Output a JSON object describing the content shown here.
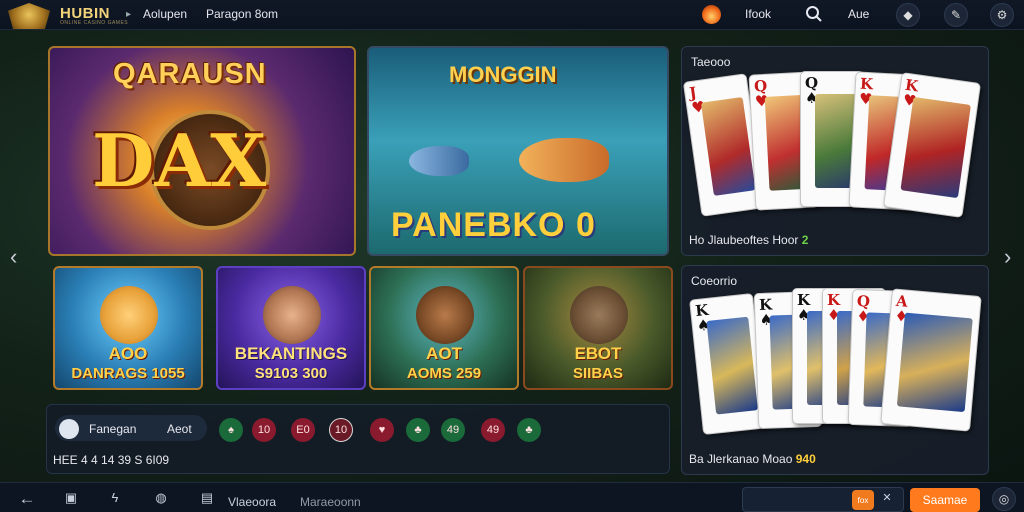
{
  "header": {
    "brand": "HUBIN",
    "brand_tagline": "ONLINE CASINO GAMES",
    "nav_links": [
      "Aolupen",
      "Paragon 8om"
    ],
    "right_links": [
      "Ifook",
      "Aue"
    ],
    "icons": [
      "fire-icon",
      "search-icon",
      "pin-icon",
      "edit-icon",
      "settings-icon"
    ]
  },
  "featured": [
    {
      "top_title": "QARAUSN",
      "main_title": "DAX"
    },
    {
      "top_title": "MONGGIN",
      "main_title": "PANEBKO 0"
    }
  ],
  "games": [
    {
      "line1": "AOO",
      "line2": "DANRAGS 1055"
    },
    {
      "line1": "BEKANTINGS",
      "line2": "S9103 300"
    },
    {
      "line1": "AOT",
      "line2": "AOMS 259"
    },
    {
      "line1": "ЕВОТ",
      "line2": "SIIBAS"
    }
  ],
  "infobar": {
    "pill_label": "Fanegan",
    "pill_value": "Aeot",
    "chips": [
      "♠",
      "10",
      "E0",
      "10",
      "♥",
      "♣",
      "49",
      "49",
      "♣"
    ],
    "line": "HEE 4 4 14 39 S 6I09"
  },
  "panels": [
    {
      "title": "Taeooo",
      "footer": "Ho Jlaubeoftes Hoor",
      "amount": "2"
    },
    {
      "title": "Coeorrio",
      "footer": "Ba Jlerkanao Moao",
      "amount": "940"
    }
  ],
  "bottom": {
    "back_label": "←",
    "tabs": [
      "Vlaeoora",
      "Maraeoonn"
    ],
    "input_badge": "fox",
    "submit": "Saamae"
  },
  "colors": {
    "accent": "#ff7a1c",
    "gold": "#ffcf3a",
    "red_chip": "#8a1b2e",
    "green_chip": "#1a6a3a"
  }
}
